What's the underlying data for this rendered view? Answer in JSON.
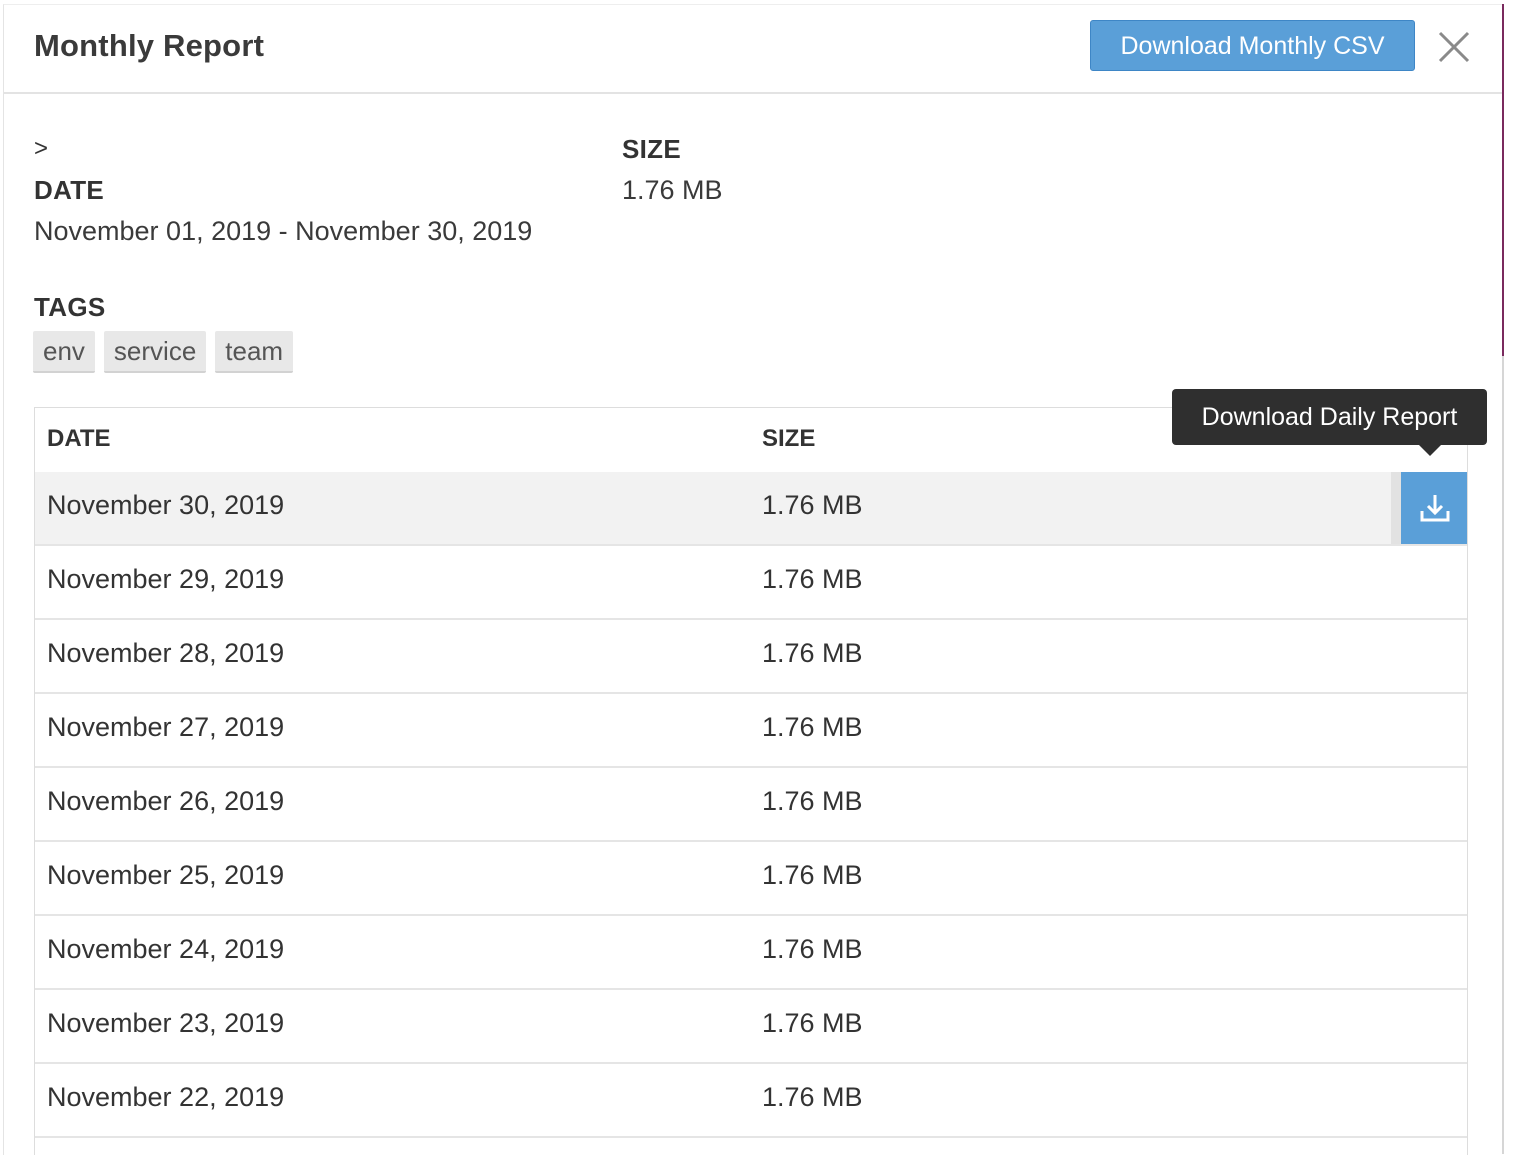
{
  "header": {
    "title": "Monthly Report",
    "download_csv_label": "Download Monthly CSV"
  },
  "meta": {
    "caret": ">",
    "date_label": "DATE",
    "date_value": "November 01, 2019 - November 30, 2019",
    "size_label": "SIZE",
    "size_value": "1.76 MB",
    "tags_label": "TAGS",
    "tags": [
      "env",
      "service",
      "team"
    ]
  },
  "table": {
    "columns": {
      "date": "DATE",
      "size": "SIZE"
    },
    "rows": [
      {
        "date": "November 30, 2019",
        "size": "1.76 MB"
      },
      {
        "date": "November 29, 2019",
        "size": "1.76 MB"
      },
      {
        "date": "November 28, 2019",
        "size": "1.76 MB"
      },
      {
        "date": "November 27, 2019",
        "size": "1.76 MB"
      },
      {
        "date": "November 26, 2019",
        "size": "1.76 MB"
      },
      {
        "date": "November 25, 2019",
        "size": "1.76 MB"
      },
      {
        "date": "November 24, 2019",
        "size": "1.76 MB"
      },
      {
        "date": "November 23, 2019",
        "size": "1.76 MB"
      },
      {
        "date": "November 22, 2019",
        "size": "1.76 MB"
      }
    ]
  },
  "tooltip": {
    "text": "Download Daily Report"
  },
  "icons": {
    "close": "close-icon",
    "download": "download-icon"
  },
  "colors": {
    "accent": "#5a9fd8",
    "tooltip_bg": "#2f2f2f"
  }
}
